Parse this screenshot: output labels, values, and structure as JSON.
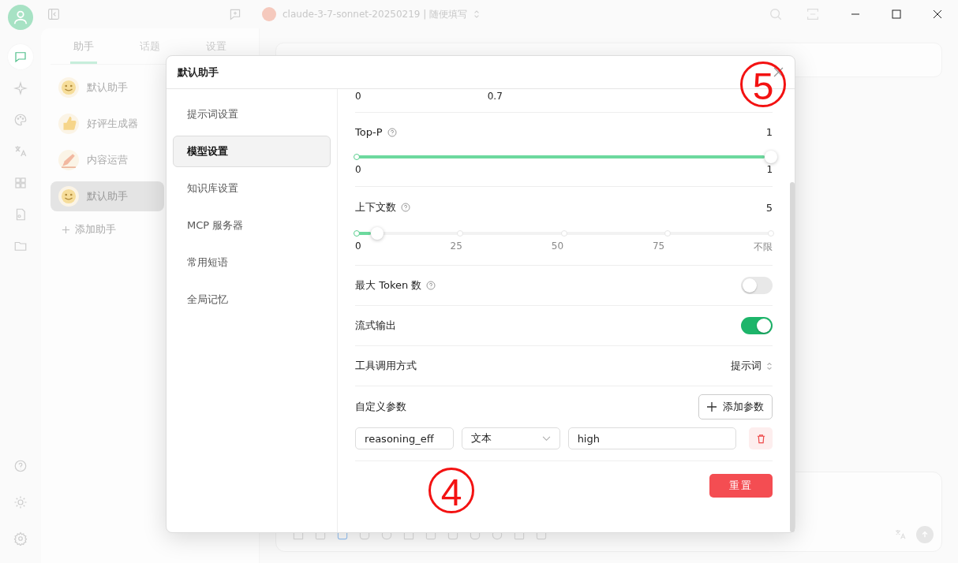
{
  "title_bar": {
    "model_name": "claude-3-7-sonnet-20250219 | 随便填写"
  },
  "rail": [
    {
      "kind": "chat",
      "selected": true
    },
    {
      "kind": "sparkle",
      "selected": false
    },
    {
      "kind": "palette",
      "selected": false
    },
    {
      "kind": "translate",
      "selected": false
    },
    {
      "kind": "grid",
      "selected": false
    },
    {
      "kind": "doc",
      "selected": false
    },
    {
      "kind": "folder",
      "selected": false
    }
  ],
  "assistant_panel": {
    "tabs": [
      {
        "label": "助手",
        "selected": true
      },
      {
        "label": "话题",
        "selected": false
      },
      {
        "label": "设置",
        "selected": false
      }
    ],
    "assistants": [
      {
        "name": "默认助手",
        "kind": "smile",
        "selected": false
      },
      {
        "name": "好评生成器",
        "kind": "thumb",
        "selected": false
      },
      {
        "name": "内容运营",
        "kind": "pen",
        "selected": false
      },
      {
        "name": "默认助手",
        "kind": "smile",
        "selected": true
      }
    ],
    "add_label": "添加助手"
  },
  "dialog": {
    "title": "默认助手",
    "nav": [
      {
        "label": "提示词设置",
        "selected": false
      },
      {
        "label": "模型设置",
        "selected": true
      },
      {
        "label": "知识库设置",
        "selected": false
      },
      {
        "label": "MCP 服务器",
        "selected": false
      },
      {
        "label": "常用短语",
        "selected": false
      },
      {
        "label": "全局记忆",
        "selected": false
      }
    ],
    "temperature_ticks": [
      "0",
      "0.7"
    ],
    "settings": [
      {
        "kind": "slider",
        "label": "Top-P",
        "help": true,
        "reading": "1",
        "level": 1,
        "ticks": [
          "0",
          "1"
        ]
      },
      {
        "kind": "slider",
        "label": "上下文数",
        "help": true,
        "reading": "5",
        "level": 0.05,
        "ticks": [
          "0",
          "25",
          "50",
          "75",
          "不限"
        ]
      },
      {
        "kind": "switch",
        "label": "最大 Token 数",
        "help": true,
        "on": false
      },
      {
        "kind": "switch",
        "label": "流式输出",
        "help": false,
        "on": true
      },
      {
        "kind": "select",
        "label": "工具调用方式",
        "value": "提示词"
      },
      {
        "kind": "params",
        "label": "自定义参数",
        "add_label": "添加参数",
        "params": [
          {
            "name": "reasoning_eff",
            "type": "文本",
            "value": "high"
          }
        ]
      }
    ],
    "reset_label": "重置"
  },
  "callouts": [
    "4",
    "5"
  ]
}
